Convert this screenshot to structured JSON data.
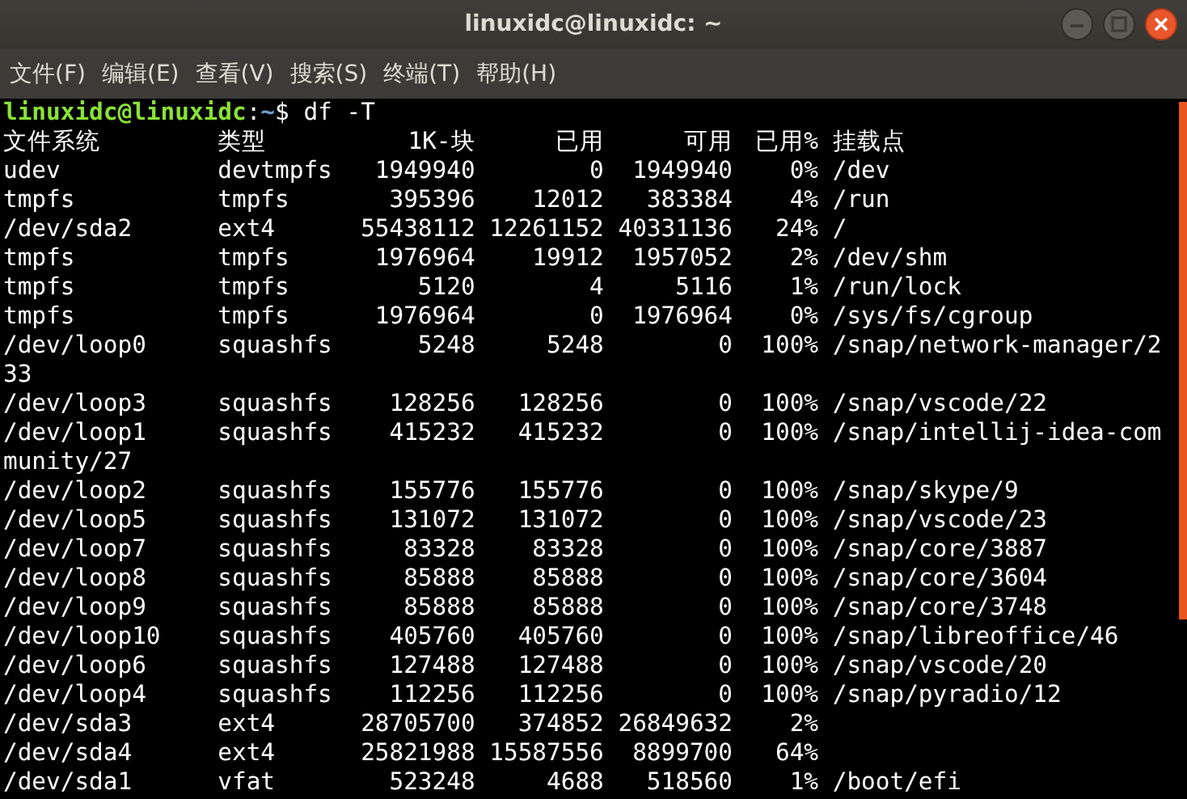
{
  "window": {
    "title": "linuxidc@linuxidc: ~"
  },
  "menu": [
    "文件(F)",
    "编辑(E)",
    "查看(V)",
    "搜索(S)",
    "终端(T)",
    "帮助(H)"
  ],
  "prompt": {
    "user_host": "linuxidc@linuxidc",
    "separator": ":",
    "path": "~",
    "symbol": "$",
    "command": "df -T"
  },
  "table": {
    "columns": [
      "文件系统",
      "类型",
      "1K-块",
      "已用",
      "可用",
      "已用%",
      "挂载点"
    ],
    "rows": [
      {
        "filesystem": "udev",
        "type": "devtmpfs",
        "blocks": "1949940",
        "used": "0",
        "available": "1949940",
        "use_percent": "0%",
        "mounted_on": "/dev"
      },
      {
        "filesystem": "tmpfs",
        "type": "tmpfs",
        "blocks": "395396",
        "used": "12012",
        "available": "383384",
        "use_percent": "4%",
        "mounted_on": "/run"
      },
      {
        "filesystem": "/dev/sda2",
        "type": "ext4",
        "blocks": "55438112",
        "used": "12261152",
        "available": "40331136",
        "use_percent": "24%",
        "mounted_on": "/"
      },
      {
        "filesystem": "tmpfs",
        "type": "tmpfs",
        "blocks": "1976964",
        "used": "19912",
        "available": "1957052",
        "use_percent": "2%",
        "mounted_on": "/dev/shm"
      },
      {
        "filesystem": "tmpfs",
        "type": "tmpfs",
        "blocks": "5120",
        "used": "4",
        "available": "5116",
        "use_percent": "1%",
        "mounted_on": "/run/lock"
      },
      {
        "filesystem": "tmpfs",
        "type": "tmpfs",
        "blocks": "1976964",
        "used": "0",
        "available": "1976964",
        "use_percent": "0%",
        "mounted_on": "/sys/fs/cgroup"
      },
      {
        "filesystem": "/dev/loop0",
        "type": "squashfs",
        "blocks": "5248",
        "used": "5248",
        "available": "0",
        "use_percent": "100%",
        "mounted_on": "/snap/network-manager/233"
      },
      {
        "filesystem": "/dev/loop3",
        "type": "squashfs",
        "blocks": "128256",
        "used": "128256",
        "available": "0",
        "use_percent": "100%",
        "mounted_on": "/snap/vscode/22"
      },
      {
        "filesystem": "/dev/loop1",
        "type": "squashfs",
        "blocks": "415232",
        "used": "415232",
        "available": "0",
        "use_percent": "100%",
        "mounted_on": "/snap/intellij-idea-community/27"
      },
      {
        "filesystem": "/dev/loop2",
        "type": "squashfs",
        "blocks": "155776",
        "used": "155776",
        "available": "0",
        "use_percent": "100%",
        "mounted_on": "/snap/skype/9"
      },
      {
        "filesystem": "/dev/loop5",
        "type": "squashfs",
        "blocks": "131072",
        "used": "131072",
        "available": "0",
        "use_percent": "100%",
        "mounted_on": "/snap/vscode/23"
      },
      {
        "filesystem": "/dev/loop7",
        "type": "squashfs",
        "blocks": "83328",
        "used": "83328",
        "available": "0",
        "use_percent": "100%",
        "mounted_on": "/snap/core/3887"
      },
      {
        "filesystem": "/dev/loop8",
        "type": "squashfs",
        "blocks": "85888",
        "used": "85888",
        "available": "0",
        "use_percent": "100%",
        "mounted_on": "/snap/core/3604"
      },
      {
        "filesystem": "/dev/loop9",
        "type": "squashfs",
        "blocks": "85888",
        "used": "85888",
        "available": "0",
        "use_percent": "100%",
        "mounted_on": "/snap/core/3748"
      },
      {
        "filesystem": "/dev/loop10",
        "type": "squashfs",
        "blocks": "405760",
        "used": "405760",
        "available": "0",
        "use_percent": "100%",
        "mounted_on": "/snap/libreoffice/46"
      },
      {
        "filesystem": "/dev/loop6",
        "type": "squashfs",
        "blocks": "127488",
        "used": "127488",
        "available": "0",
        "use_percent": "100%",
        "mounted_on": "/snap/vscode/20"
      },
      {
        "filesystem": "/dev/loop4",
        "type": "squashfs",
        "blocks": "112256",
        "used": "112256",
        "available": "0",
        "use_percent": "100%",
        "mounted_on": "/snap/pyradio/12"
      },
      {
        "filesystem": "/dev/sda3",
        "type": "ext4",
        "blocks": "28705700",
        "used": "374852",
        "available": "26849632",
        "use_percent": "2%"
      },
      {
        "filesystem": "/dev/sda4",
        "type": "ext4",
        "blocks": "25821988",
        "used": "15587556",
        "available": "8899700",
        "use_percent": "64%"
      },
      {
        "filesystem": "/dev/sda1",
        "type": "vfat",
        "blocks": "523248",
        "used": "4688",
        "available": "518560",
        "use_percent": "1%",
        "mounted_on": "/boot/efi"
      }
    ]
  }
}
